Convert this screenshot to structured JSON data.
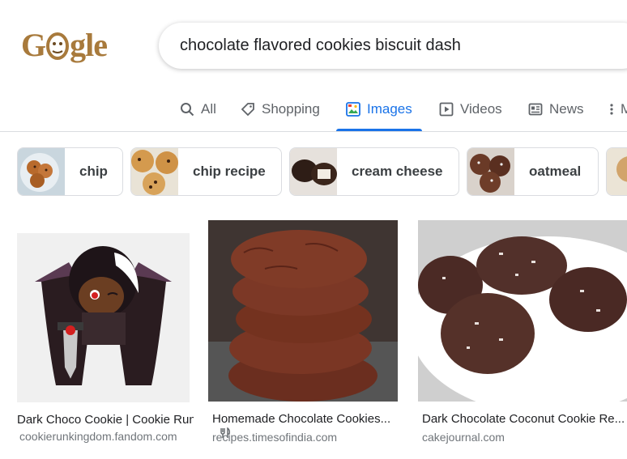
{
  "search": {
    "query": "chocolate flavored cookies biscuit dash"
  },
  "logo": {
    "text_left": "G",
    "text_right": "gle"
  },
  "tabs": [
    {
      "label": "All",
      "icon": "search-icon"
    },
    {
      "label": "Shopping",
      "icon": "tag-icon"
    },
    {
      "label": "Images",
      "icon": "image-icon",
      "active": true
    },
    {
      "label": "Videos",
      "icon": "play-icon"
    },
    {
      "label": "News",
      "icon": "newspaper-icon"
    },
    {
      "label": "M",
      "icon": "more-vert-icon"
    }
  ],
  "chips": [
    {
      "label": "chip"
    },
    {
      "label": "chip recipe"
    },
    {
      "label": "cream cheese"
    },
    {
      "label": "oatmeal"
    }
  ],
  "results": [
    {
      "title": "Dark Choco Cookie | Cookie Run...",
      "site": "cookierunkingdom.fandom.com"
    },
    {
      "title": "Homemade Chocolate Cookies...",
      "site": "recipes.timesofindia.com",
      "badge_icon": "fork-knife-icon"
    },
    {
      "title": "Dark Chocolate Coconut Cookie Re...",
      "site": "cakejournal.com"
    }
  ],
  "colors": {
    "accent": "#1a73e8",
    "logo": "#a87a3c",
    "text": "#202124",
    "muted": "#5f6368"
  }
}
